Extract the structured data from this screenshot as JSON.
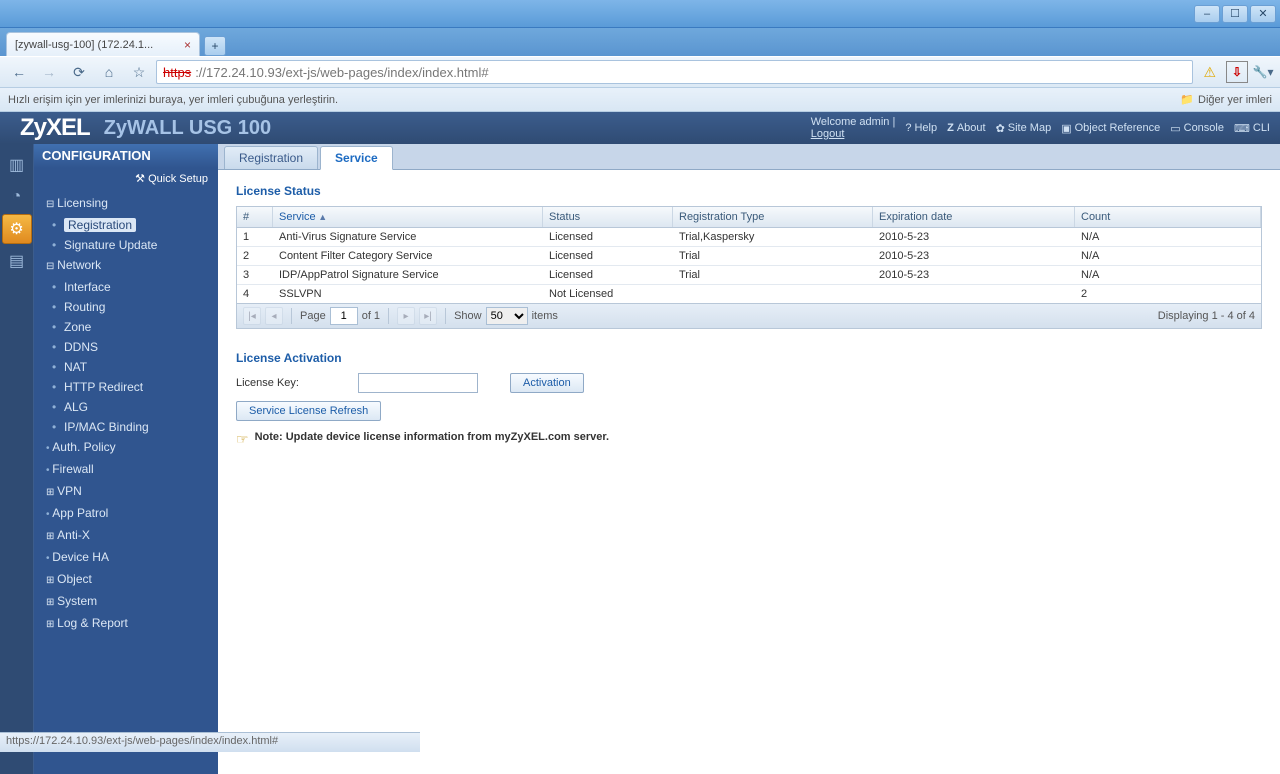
{
  "browser": {
    "tab_title": "[zywall-usg-100] (172.24.1...",
    "bookmark_hint": "Hızlı erişim için yer imlerinizi buraya, yer imleri çubuğuna yerleştirin.",
    "other_bookmarks": "Diğer yer imleri",
    "url_scheme": "https",
    "url_rest": "://172.24.10.93/ext-js/web-pages/index/index.html#",
    "status_url": "https://172.24.10.93/ext-js/web-pages/index/index.html#"
  },
  "app": {
    "logo": "ZyXEL",
    "product": "ZyWALL USG 100",
    "welcome": "Welcome admin",
    "logout": "Logout",
    "links": {
      "help": "Help",
      "about": "About",
      "sitemap": "Site Map",
      "objref": "Object Reference",
      "console": "Console",
      "cli": "CLI"
    }
  },
  "sidebar": {
    "title": "CONFIGURATION",
    "quick": "Quick Setup",
    "tree": [
      {
        "lvl": 1,
        "label": "Licensing",
        "open": true
      },
      {
        "lvl": 2,
        "label": "Registration",
        "sel": true
      },
      {
        "lvl": 2,
        "label": "Signature Update"
      },
      {
        "lvl": 1,
        "label": "Network",
        "open": true
      },
      {
        "lvl": 2,
        "label": "Interface"
      },
      {
        "lvl": 2,
        "label": "Routing"
      },
      {
        "lvl": 2,
        "label": "Zone"
      },
      {
        "lvl": 2,
        "label": "DDNS"
      },
      {
        "lvl": 2,
        "label": "NAT"
      },
      {
        "lvl": 2,
        "label": "HTTP Redirect"
      },
      {
        "lvl": 2,
        "label": "ALG"
      },
      {
        "lvl": 2,
        "label": "IP/MAC Binding"
      },
      {
        "lvl": 1,
        "label": "Auth. Policy",
        "leaf": true
      },
      {
        "lvl": 1,
        "label": "Firewall",
        "leaf": true
      },
      {
        "lvl": 1,
        "label": "VPN",
        "collapsed": true
      },
      {
        "lvl": 1,
        "label": "App Patrol",
        "leaf": true
      },
      {
        "lvl": 1,
        "label": "Anti-X",
        "collapsed": true
      },
      {
        "lvl": 1,
        "label": "Device HA",
        "leaf": true
      },
      {
        "lvl": 1,
        "label": "Object",
        "collapsed": true
      },
      {
        "lvl": 1,
        "label": "System",
        "collapsed": true
      },
      {
        "lvl": 1,
        "label": "Log & Report",
        "collapsed": true
      }
    ]
  },
  "tabs": {
    "registration": "Registration",
    "service": "Service"
  },
  "license_status": {
    "title": "License Status",
    "columns": {
      "num": "#",
      "service": "Service",
      "status": "Status",
      "regtype": "Registration Type",
      "exp": "Expiration date",
      "count": "Count"
    },
    "rows": [
      {
        "n": "1",
        "svc": "Anti-Virus Signature Service",
        "st": "Licensed",
        "rt": "Trial,Kaspersky",
        "ex": "2010-5-23",
        "ct": "N/A"
      },
      {
        "n": "2",
        "svc": "Content Filter Category Service",
        "st": "Licensed",
        "rt": "Trial",
        "ex": "2010-5-23",
        "ct": "N/A"
      },
      {
        "n": "3",
        "svc": "IDP/AppPatrol Signature Service",
        "st": "Licensed",
        "rt": "Trial",
        "ex": "2010-5-23",
        "ct": "N/A"
      },
      {
        "n": "4",
        "svc": "SSLVPN",
        "st": "Not Licensed",
        "rt": "",
        "ex": "",
        "ct": "2"
      }
    ],
    "paging": {
      "page_label": "Page",
      "of": "of 1",
      "page": "1",
      "show": "Show",
      "items": "items",
      "per": "50",
      "displaying": "Displaying 1 - 4 of 4"
    }
  },
  "license_activation": {
    "title": "License Activation",
    "key_label": "License Key:",
    "activation_btn": "Activation",
    "refresh_btn": "Service License Refresh",
    "note": "Note: Update device license information from myZyXEL.com server."
  }
}
